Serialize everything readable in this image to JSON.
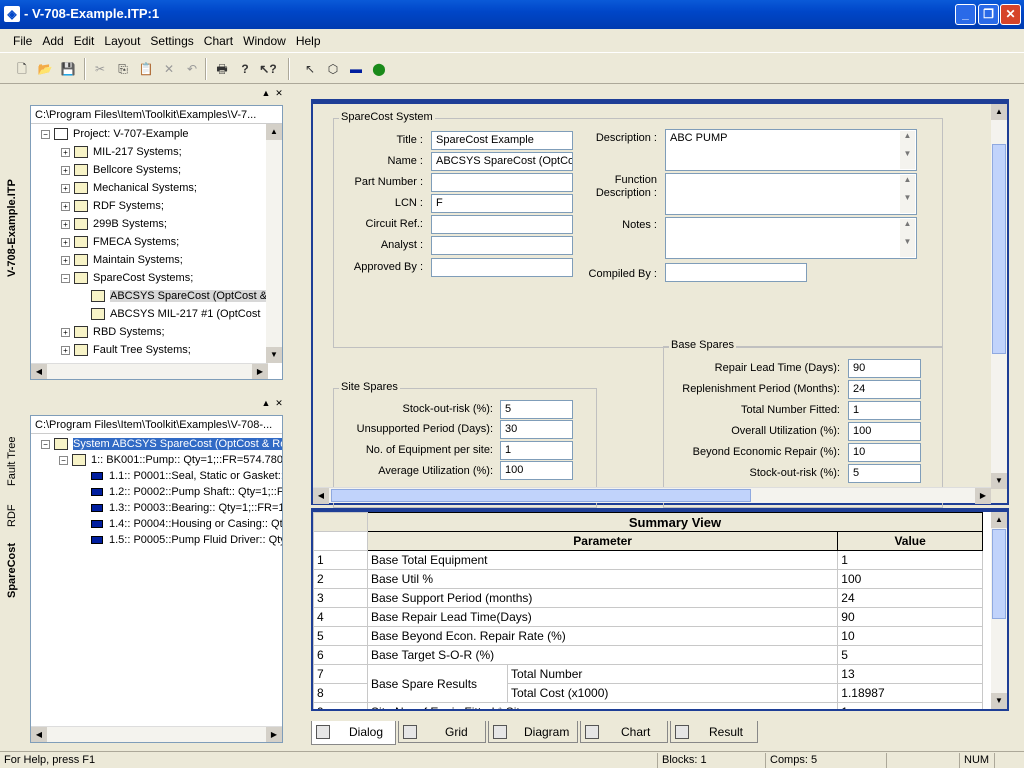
{
  "window": {
    "title": " - V-708-Example.ITP:1"
  },
  "menu": [
    "File",
    "Add",
    "Edit",
    "Layout",
    "Settings",
    "Chart",
    "Window",
    "Help"
  ],
  "top_tree": {
    "path": "C:\\Program Files\\Item\\Toolkit\\Examples\\V-7...",
    "items": [
      {
        "label": "Project:  V-707-Example",
        "exp": "−"
      },
      {
        "label": "MIL-217 Systems;",
        "exp": "+"
      },
      {
        "label": "Bellcore Systems;",
        "exp": "+"
      },
      {
        "label": "Mechanical Systems;",
        "exp": "+"
      },
      {
        "label": "RDF Systems;",
        "exp": "+"
      },
      {
        "label": "299B Systems;",
        "exp": "+"
      },
      {
        "label": "FMECA Systems;",
        "exp": "+"
      },
      {
        "label": "Maintain Systems;",
        "exp": "+"
      },
      {
        "label": "SpareCost Systems;",
        "exp": "−"
      },
      {
        "label": "ABCSYS SpareCost (OptCost &",
        "exp": ""
      },
      {
        "label": "ABCSYS MIL-217 #1 (OptCost",
        "exp": ""
      },
      {
        "label": "RBD Systems;",
        "exp": "+"
      },
      {
        "label": "Fault Tree Systems;",
        "exp": "+"
      }
    ],
    "side_tab": "V-708-Example.ITP"
  },
  "bottom_tree": {
    "path": "C:\\Program Files\\Item\\Toolkit\\Examples\\V-708-...",
    "items": [
      {
        "label": "System ABCSYS SpareCost (OptCost & Rep"
      },
      {
        "label": "1:: BK001::Pump:: Qty=1;::FR=574.780"
      },
      {
        "label": "1.1:: P0001::Seal, Static or Gasket::"
      },
      {
        "label": "1.2:: P0002::Pump Shaft:: Qty=1;::F"
      },
      {
        "label": "1.3:: P0003::Bearing:: Qty=1;::FR=1"
      },
      {
        "label": "1.4:: P0004::Housing or Casing:: Qty"
      },
      {
        "label": "1.5:: P0005::Pump Fluid Driver:: Qty"
      }
    ],
    "side_tabs": [
      "Fault Tree",
      "RDF",
      "SpareCost"
    ]
  },
  "form": {
    "group_title": "SpareCost System",
    "title_label": "Title :",
    "title_value": "SpareCost Example",
    "name_label": "Name :",
    "name_value": "ABCSYS SpareCost (OptCos",
    "part_label": "Part Number :",
    "part_value": "",
    "lcn_label": "LCN :",
    "lcn_value": "F",
    "circuit_label": "Circuit Ref.:",
    "circuit_value": "",
    "analyst_label": "Analyst :",
    "analyst_value": "",
    "approved_label": "Approved By :",
    "approved_value": "",
    "description_label": "Description :",
    "description_value": "ABC PUMP",
    "function_label": "Function\nDescription :",
    "function_value": "",
    "notes_label": "Notes :",
    "notes_value": "",
    "compiled_label": "Compiled By :",
    "compiled_value": "",
    "site": {
      "title": "Site Spares",
      "stock_label": "Stock-out-risk (%):",
      "stock_value": "5",
      "unsupported_label": "Unsupported Period (Days):",
      "unsupported_value": "30",
      "equip_label": "No. of Equipment per site:",
      "equip_value": "1",
      "util_label": "Average Utilization (%):",
      "util_value": "100"
    },
    "base": {
      "title": "Base Spares",
      "repair_label": "Repair Lead Time (Days):",
      "repair_value": "90",
      "replenish_label": "Replenishment Period (Months):",
      "replenish_value": "24",
      "fitted_label": "Total Number Fitted:",
      "fitted_value": "1",
      "overall_label": "Overall Utilization (%):",
      "overall_value": "100",
      "beyond_label": "Beyond Economic Repair (%):",
      "beyond_value": "10",
      "stock_label": "Stock-out-risk (%):",
      "stock_value": "5"
    }
  },
  "summary": {
    "title": "Summary View",
    "col_param": "Parameter",
    "col_value": "Value",
    "rows": [
      {
        "n": "1",
        "p": "Base Total Equipment",
        "v": "1"
      },
      {
        "n": "2",
        "p": "Base Util %",
        "v": "100"
      },
      {
        "n": "3",
        "p": "Base Support Period (months)",
        "v": "24"
      },
      {
        "n": "4",
        "p": "Base Repair Lead Time(Days)",
        "v": "90"
      },
      {
        "n": "5",
        "p": "Base Beyond Econ. Repair Rate (%)",
        "v": "10"
      },
      {
        "n": "6",
        "p": "Base Target S-O-R (%)",
        "v": "5"
      }
    ],
    "group_label": "Base Spare Results",
    "sub_rows": [
      {
        "n": "7",
        "s": "Total Number",
        "v": "13"
      },
      {
        "n": "8",
        "s": "Total Cost (x1000)",
        "v": "1.18987"
      }
    ],
    "partial_row": {
      "n": "9",
      "p": "Site No. of Equip Fitted * Site",
      "v": "1"
    }
  },
  "tabs": [
    "Dialog",
    "Grid",
    "Diagram",
    "Chart",
    "Result"
  ],
  "status": {
    "help": "For Help, press F1",
    "blocks": "Blocks: 1",
    "comps": "Comps: 5",
    "num": "NUM"
  }
}
